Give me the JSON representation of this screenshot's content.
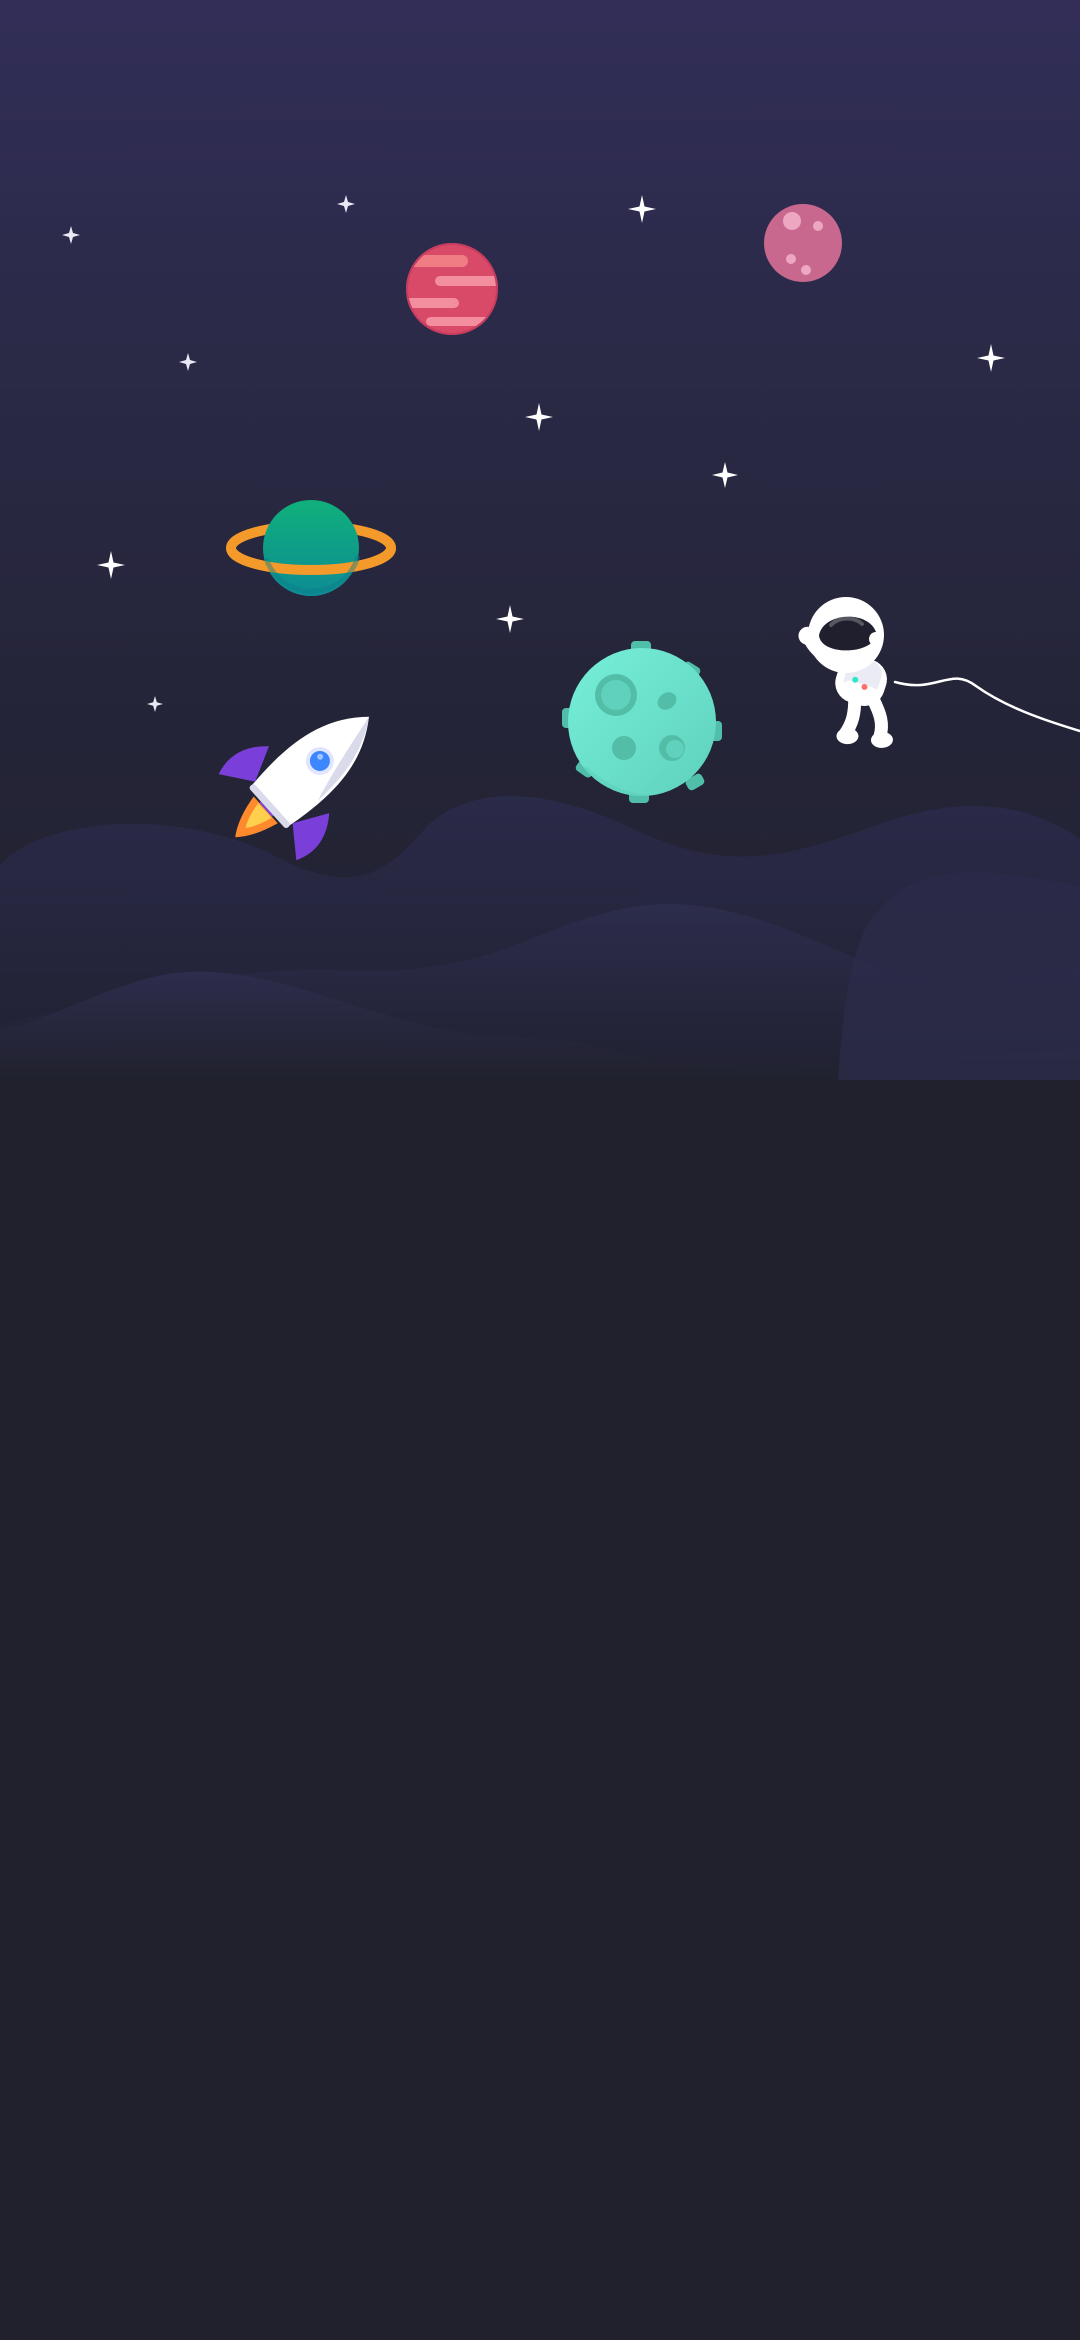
{
  "screen": {
    "type": "wallpaper",
    "theme": "space"
  },
  "colors": {
    "sky_top": "#322e58",
    "sky_bottom": "#20212d",
    "background": "#20212d",
    "hill_dark": "#272840",
    "hill_mid": "#2a2a48",
    "hill_front": "#2b2b4a",
    "star": "#e9e9f6",
    "planet_pink_stripes_base": "#e25a6e",
    "planet_pink_stripes_light": "#f38e9e",
    "planet_mauve": "#c9688f",
    "planet_mauve_spots": "#eda7c1",
    "saturn_body": "#0fa488",
    "saturn_ring": "#f39a2a",
    "moon_body": "#6fe6cf",
    "moon_craters": "#52bea8",
    "rocket_body": "#ffffff",
    "rocket_fins": "#7b3fd9",
    "rocket_window": "#3c86ff",
    "rocket_flame": "#ffb12b",
    "astronaut_suit": "#ffffff",
    "astronaut_visor": "#1f1f2d",
    "tether": "#ffffff"
  },
  "illustrations": [
    "stars",
    "striped-pink-planet",
    "mauve-planet",
    "ringed-planet",
    "cratered-moon",
    "rocket",
    "floating-astronaut",
    "hills"
  ]
}
